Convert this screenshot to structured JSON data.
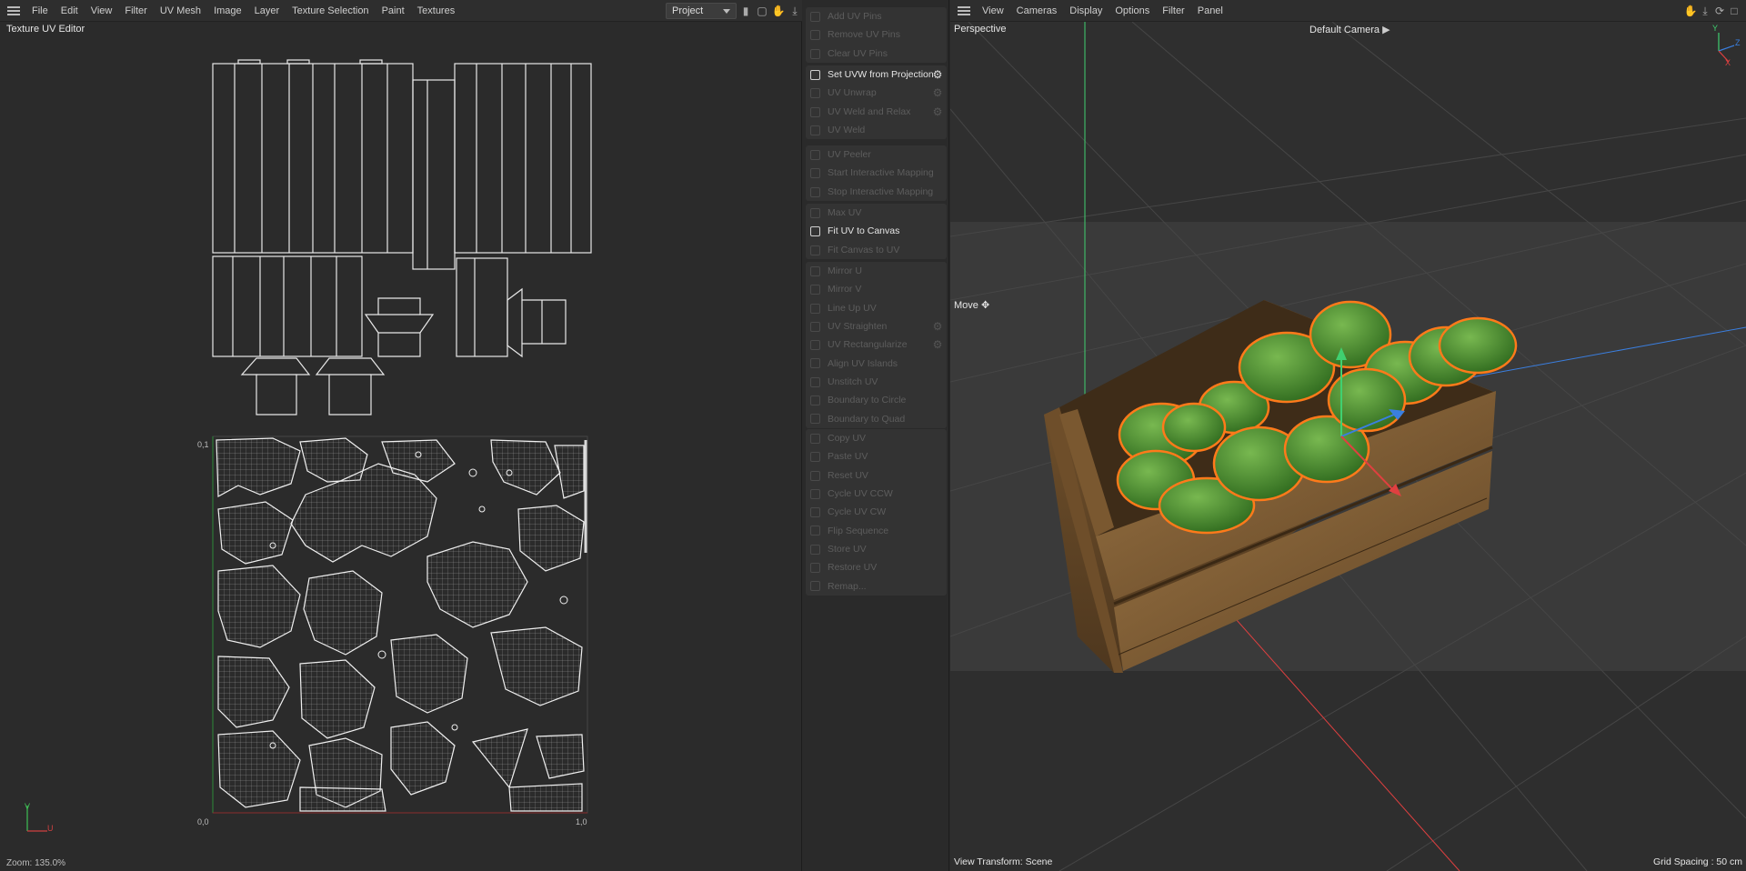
{
  "uv_editor": {
    "menu": [
      "File",
      "Edit",
      "View",
      "Filter",
      "UV Mesh",
      "Image",
      "Layer",
      "Texture Selection",
      "Paint",
      "Textures"
    ],
    "project_select": "Project",
    "title": "Texture UV Editor",
    "axis": {
      "origin": "0,0",
      "u_max": "1,0",
      "v_max": "0,1",
      "v_letter": "V",
      "u_letter": "U"
    },
    "zoom_status": "Zoom: 135.0%"
  },
  "commands": {
    "groups": [
      [
        {
          "label": "Add UV Pins",
          "enabled": false,
          "gear": false
        },
        {
          "label": "Remove UV Pins",
          "enabled": false,
          "gear": false
        },
        {
          "label": "Clear UV Pins",
          "enabled": false,
          "gear": false
        }
      ],
      [
        {
          "label": "Set UVW from Projection",
          "enabled": true,
          "gear": true
        },
        {
          "label": "UV Unwrap",
          "enabled": false,
          "gear": true
        },
        {
          "label": "UV Weld and Relax",
          "enabled": false,
          "gear": true
        },
        {
          "label": "UV Weld",
          "enabled": false,
          "gear": false
        }
      ],
      [
        {
          "label": "UV Peeler",
          "enabled": false,
          "gear": false
        },
        {
          "label": "Start Interactive Mapping",
          "enabled": false,
          "gear": false
        },
        {
          "label": "Stop Interactive Mapping",
          "enabled": false,
          "gear": false
        }
      ],
      [
        {
          "label": "Max UV",
          "enabled": false,
          "gear": false
        },
        {
          "label": "Fit UV to Canvas",
          "enabled": true,
          "gear": false
        },
        {
          "label": "Fit Canvas to UV",
          "enabled": false,
          "gear": false
        }
      ],
      [
        {
          "label": "Mirror U",
          "enabled": false,
          "gear": false
        },
        {
          "label": "Mirror V",
          "enabled": false,
          "gear": false
        },
        {
          "label": "Line Up UV",
          "enabled": false,
          "gear": false
        },
        {
          "label": "UV Straighten",
          "enabled": false,
          "gear": true
        },
        {
          "label": "UV Rectangularize",
          "enabled": false,
          "gear": true
        },
        {
          "label": "Align UV Islands",
          "enabled": false,
          "gear": false
        },
        {
          "label": "Unstitch UV",
          "enabled": false,
          "gear": false
        },
        {
          "label": "Boundary to Circle",
          "enabled": false,
          "gear": false
        },
        {
          "label": "Boundary to Quad",
          "enabled": false,
          "gear": false
        }
      ],
      [
        {
          "label": "Copy UV",
          "enabled": false,
          "gear": false
        },
        {
          "label": "Paste UV",
          "enabled": false,
          "gear": false
        },
        {
          "label": "Reset UV",
          "enabled": false,
          "gear": false
        },
        {
          "label": "Cycle UV CCW",
          "enabled": false,
          "gear": false
        },
        {
          "label": "Cycle UV CW",
          "enabled": false,
          "gear": false
        },
        {
          "label": "Flip Sequence",
          "enabled": false,
          "gear": false
        },
        {
          "label": "Store UV",
          "enabled": false,
          "gear": false
        },
        {
          "label": "Restore UV",
          "enabled": false,
          "gear": false
        },
        {
          "label": "Remap...",
          "enabled": false,
          "gear": false
        }
      ]
    ]
  },
  "viewport": {
    "menu": [
      "View",
      "Cameras",
      "Display",
      "Options",
      "Filter",
      "Panel"
    ],
    "view_name": "Perspective",
    "camera": "Default Camera",
    "tool": "Move",
    "view_transform": "View Transform: Scene",
    "grid_spacing": "Grid Spacing : 50 cm",
    "axis_letters": [
      "Y",
      "Z",
      "X"
    ]
  },
  "colors": {
    "x_axis": "#e04040",
    "y_axis": "#40d070",
    "z_axis": "#3a7fe0",
    "selection_outline": "#ff7a1a",
    "fruit": "#4c8a30",
    "crate": "#8a6438"
  }
}
